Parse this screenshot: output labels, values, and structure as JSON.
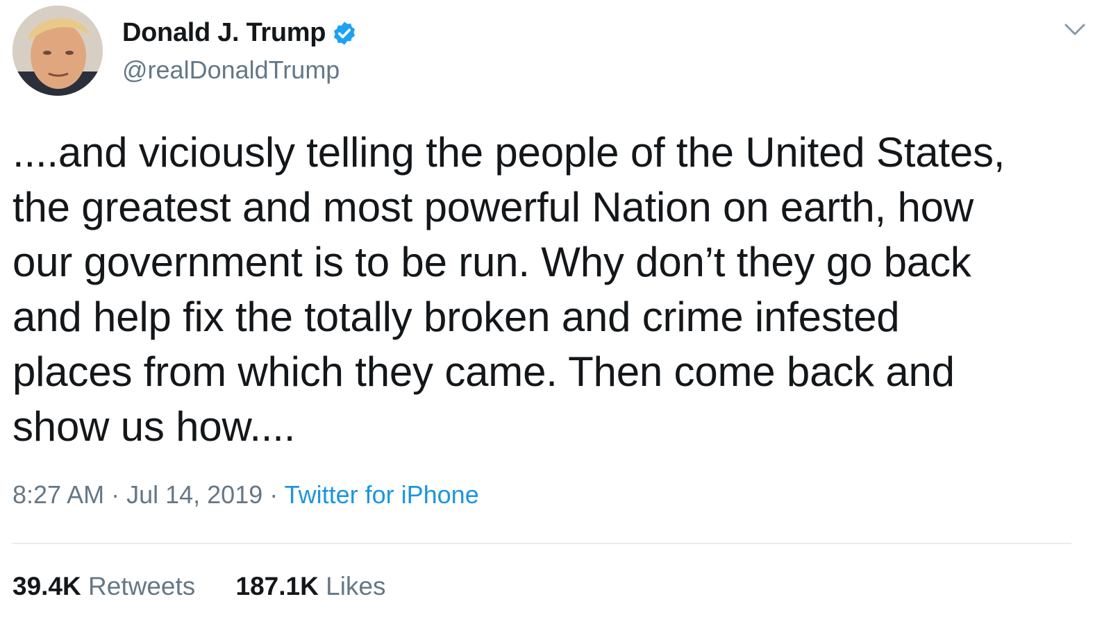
{
  "author": {
    "display_name": "Donald J. Trump",
    "handle": "@realDonaldTrump",
    "verified_icon": "verified-badge-icon",
    "avatar": "profile-photo"
  },
  "tweet": {
    "text": "....and viciously telling the people of the United States,\nthe greatest and most powerful Nation on earth, how\nour government is to be run. Why don’t they go back\nand help fix the totally broken and crime infested\nplaces from which they came. Then come back and\nshow us how...."
  },
  "meta": {
    "time": "8:27 AM",
    "separator": " · ",
    "date": "Jul 14, 2019",
    "source": "Twitter for iPhone"
  },
  "stats": {
    "retweets_count": "39.4K",
    "retweets_label": "Retweets",
    "likes_count": "187.1K",
    "likes_label": "Likes"
  },
  "colors": {
    "text": "#14171a",
    "muted": "#657786",
    "link": "#1b95e0",
    "verified": "#1da1f2",
    "divider": "#e6ecf0"
  }
}
